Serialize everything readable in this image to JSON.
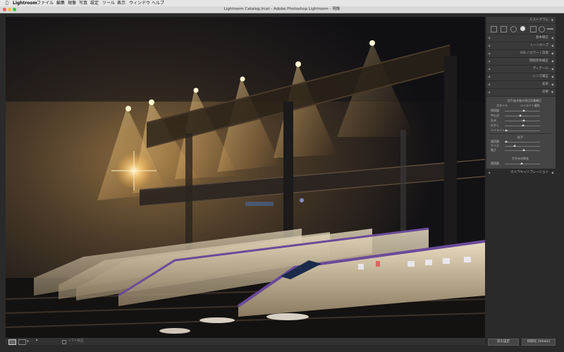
{
  "menubar": {
    "app_name": "Lightroom",
    "items": [
      "ファイル",
      "編集",
      "現像",
      "写真",
      "設定",
      "ツール",
      "表示",
      "ウィンドウ",
      "ヘルプ"
    ]
  },
  "window": {
    "title": "Lightroom Catalog.lrcat - Adobe Photoshop Lightroom - 現像"
  },
  "panel": {
    "histogram": "ヒストグラム",
    "sections": [
      "基本補正",
      "トーンカーブ",
      "HSL / カラー / 白黒",
      "明暗別色補正",
      "ディテール",
      "レンズ補正",
      "変形"
    ],
    "effects": {
      "title": "効果",
      "vignette": {
        "heading": "切り抜き後の周辺光量補正",
        "style_label": "スタイル",
        "style_value": "ハイライト優先",
        "sliders": [
          "適用量",
          "中心点",
          "丸み",
          "ぼかし",
          "ハイライト"
        ]
      },
      "grain": {
        "heading": "粒子",
        "sliders": [
          "適用量",
          "サイズ",
          "粗さ"
        ]
      },
      "dehaze": {
        "heading": "かすみの除去",
        "sliders": [
          "適用量"
        ]
      }
    },
    "camera_calibration": "カメラキャリブレーション"
  },
  "toolbar": {
    "soft_proof": "ソフト校正"
  },
  "buttons": {
    "previous": "前の設定",
    "reset": "初期化 (Adobe)"
  },
  "colors": {
    "accent_light": "#f5c060",
    "panel_bg": "#3a3a3a",
    "train_purple": "#6a4a9a"
  }
}
